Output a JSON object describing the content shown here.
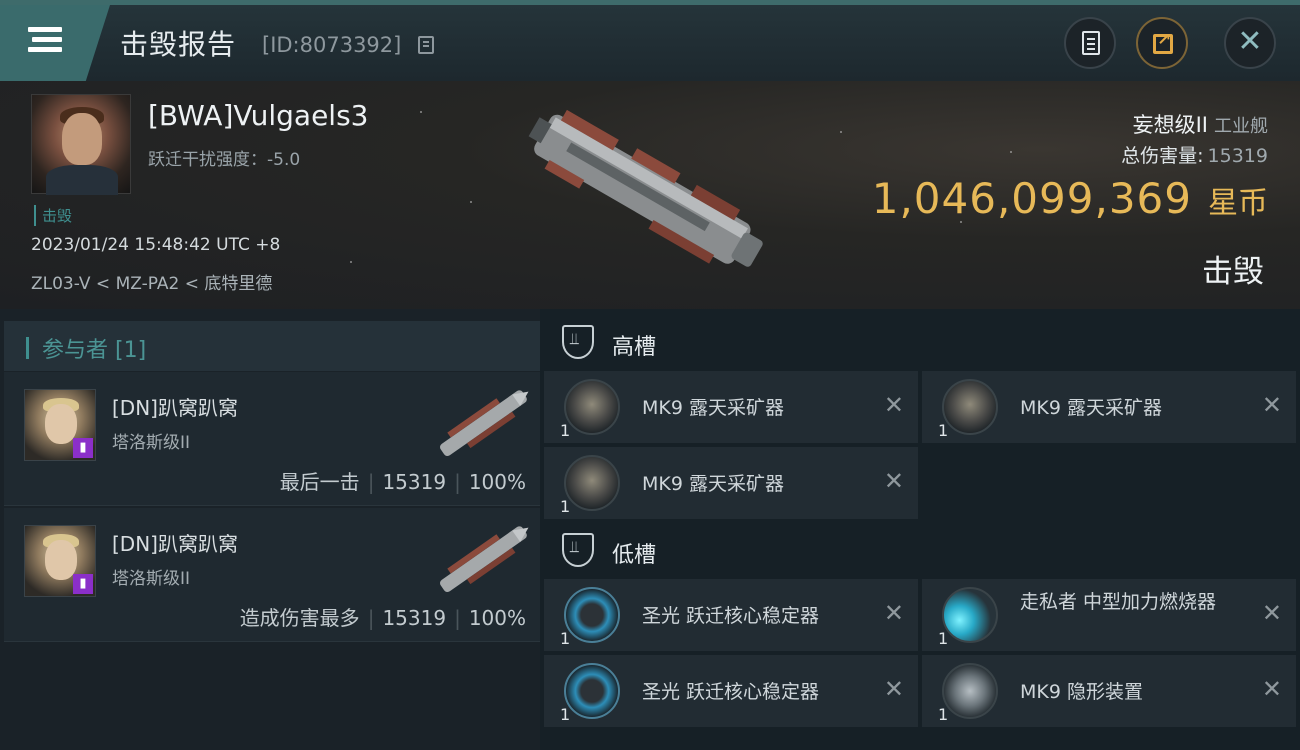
{
  "header": {
    "title": "击毁报告",
    "id_text": "[ID:8073392]"
  },
  "victim": {
    "name": "[BWA]Vulgaels3",
    "disrupt_text": "跃迁干扰强度：-5.0",
    "status_tag": "击毁",
    "timestamp": "2023/01/24 15:48:42 UTC +8",
    "location": "ZL03-V < MZ-PA2 < 底特里德",
    "ship_name": "妄想级II",
    "ship_type": "工业舰",
    "damage_label": "总伤害量:",
    "damage_value": "15319",
    "isk_value": "1,046,099,369",
    "isk_unit": "星币",
    "result": "击毁"
  },
  "participants": {
    "title": "参与者 [1]",
    "items": [
      {
        "name": "[DN]趴窝趴窝",
        "ship": "塔洛斯级II",
        "role": "最后一击",
        "damage": "15319",
        "percent": "100%"
      },
      {
        "name": "[DN]趴窝趴窝",
        "ship": "塔洛斯级II",
        "role": "造成伤害最多",
        "damage": "15319",
        "percent": "100%"
      }
    ]
  },
  "fitting": {
    "high_title": "高槽",
    "low_title": "低槽",
    "high": [
      {
        "qty": "1",
        "name": "MK9 露天采矿器",
        "icon": "mining-laser-icon"
      },
      {
        "qty": "1",
        "name": "MK9 露天采矿器",
        "icon": "mining-laser-icon"
      },
      {
        "qty": "1",
        "name": "MK9 露天采矿器",
        "icon": "mining-laser-icon"
      }
    ],
    "low": [
      {
        "qty": "1",
        "name": "圣光 跃迁核心稳定器",
        "icon": "warp-core-stabilizer-icon"
      },
      {
        "qty": "1",
        "name": "走私者 中型加力燃烧器",
        "icon": "afterburner-icon"
      },
      {
        "qty": "1",
        "name": "圣光 跃迁核心稳定器",
        "icon": "warp-core-stabilizer-icon"
      },
      {
        "qty": "1",
        "name": "MK9 隐形装置",
        "icon": "cloaking-device-icon"
      }
    ],
    "remove_glyph": "✕"
  },
  "colors": {
    "accent_teal": "#3f8f8f",
    "gold": "#e7b958",
    "purple_badge": "#8b2fc9"
  }
}
